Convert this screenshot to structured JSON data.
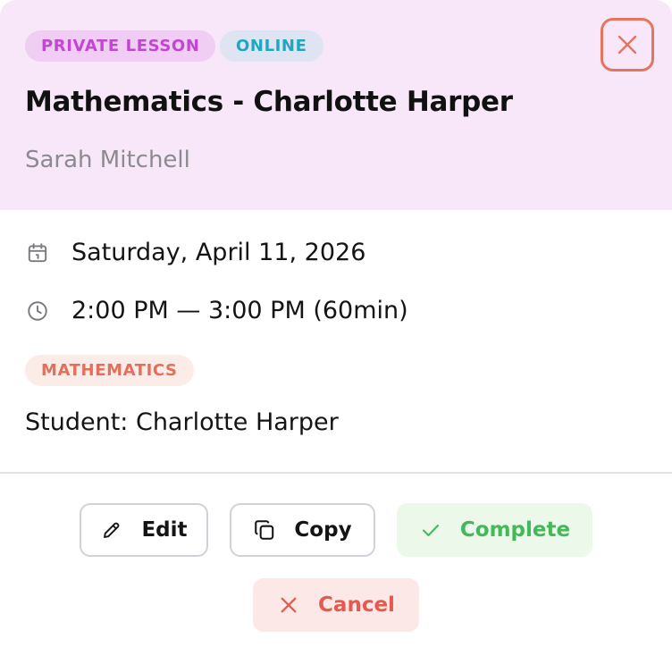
{
  "header": {
    "badges": [
      "PRIVATE LESSON",
      "ONLINE"
    ],
    "title": "Mathematics - Charlotte Harper",
    "subtitle": "Sarah Mitchell",
    "close_icon": "close-icon"
  },
  "details": {
    "date": "Saturday, April 11, 2026",
    "date_icon": "calendar-icon",
    "time": "2:00 PM — 3:00 PM (60min)",
    "time_icon": "clock-icon",
    "subject_tag": "MATHEMATICS",
    "student": "Student: Charlotte Harper"
  },
  "actions": {
    "edit_label": "Edit",
    "copy_label": "Copy",
    "complete_label": "Complete",
    "cancel_label": "Cancel"
  },
  "colors": {
    "header_bg": "#f7e7f8",
    "private_badge": "#c147d3",
    "online_badge": "#1ea7c1",
    "subject_tag": "#e2705b",
    "complete": "#43b95a",
    "cancel": "#e55a4f",
    "close_border": "#e5745d"
  }
}
